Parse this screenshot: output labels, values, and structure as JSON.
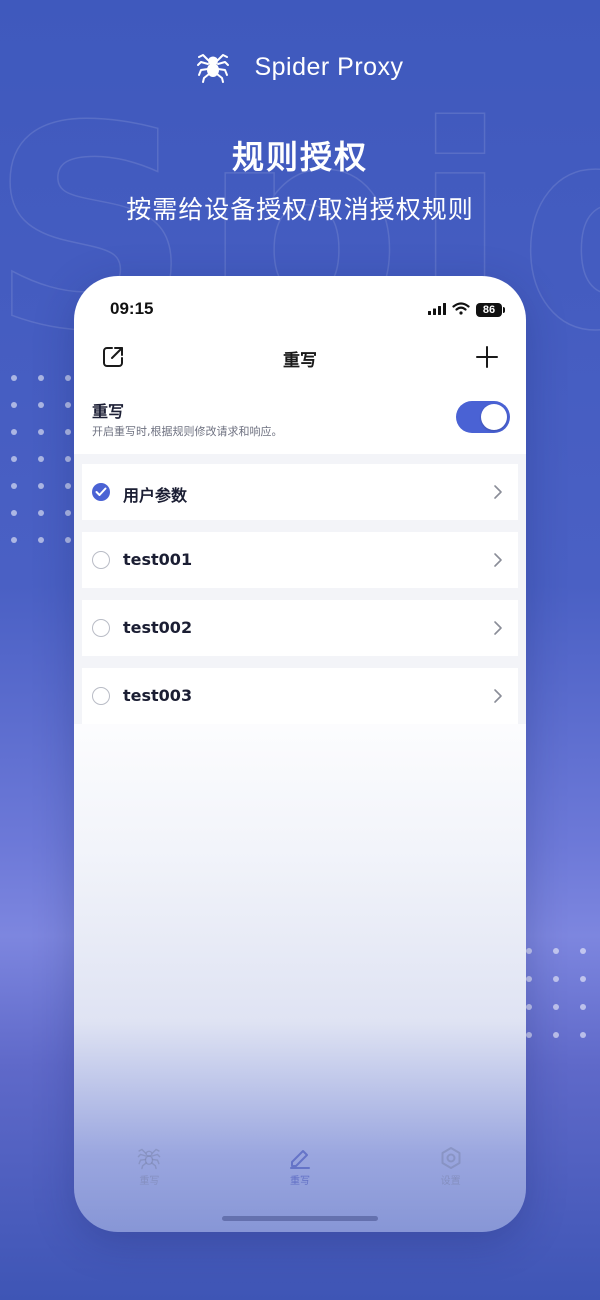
{
  "brand": {
    "name": "Spider Proxy",
    "logo_icon": "spider-icon"
  },
  "hero": {
    "title": "规则授权",
    "subtitle": "按需给设备授权/取消授权规则"
  },
  "status_bar": {
    "time": "09:15",
    "battery": "86"
  },
  "nav": {
    "title": "重写",
    "left_icon": "share-icon",
    "right_icon": "plus-icon"
  },
  "rewrite_toggle": {
    "title": "重写",
    "description": "开启重写时,根据规则修改请求和响应。",
    "enabled": true
  },
  "rules": [
    {
      "label": "用户参数",
      "checked": true
    },
    {
      "label": "test001",
      "checked": false
    },
    {
      "label": "test002",
      "checked": false
    },
    {
      "label": "test003",
      "checked": false
    }
  ],
  "tabs": [
    {
      "label": "重写",
      "icon": "spider-icon",
      "active": false
    },
    {
      "label": "重写",
      "icon": "pen-icon",
      "active": true
    },
    {
      "label": "设置",
      "icon": "settings-icon",
      "active": false
    }
  ],
  "colors": {
    "accent": "#4a62d4",
    "background": "#4a60c4"
  }
}
